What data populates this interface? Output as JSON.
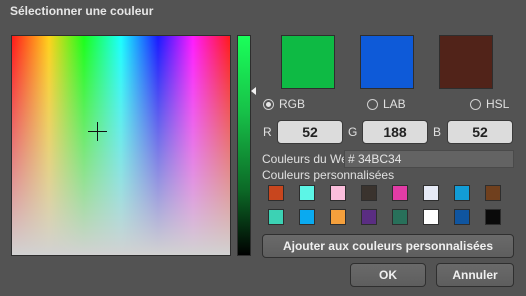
{
  "dialog": {
    "title": "Sélectionner une couleur"
  },
  "preview": {
    "swatches": [
      "#0EBA44",
      "#0E5AD8",
      "#512319"
    ]
  },
  "modes": [
    {
      "label": "RGB",
      "selected": true
    },
    {
      "label": "LAB",
      "selected": false
    },
    {
      "label": "HSL",
      "selected": false
    }
  ],
  "rgb": {
    "r_label": "R",
    "r_value": "52",
    "g_label": "G",
    "g_value": "188",
    "b_label": "B",
    "b_value": "52"
  },
  "web": {
    "label": "Couleurs du Web",
    "hex": "# 34BC34"
  },
  "custom": {
    "label": "Couleurs personnalisées",
    "swatches": [
      "#C8461E",
      "#5CF5E6",
      "#FBBEDC",
      "#3A332E",
      "#E23CA6",
      "#E6EAF6",
      "#129CD6",
      "#70401E",
      "#3CD2B4",
      "#0AAAF0",
      "#F5A03C",
      "#5A2D82",
      "#28705A",
      "#FFFFFF",
      "#0F55A0",
      "#0A0A0A"
    ],
    "add_label": "Ajouter aux couleurs personnalisées"
  },
  "buttons": {
    "ok": "OK",
    "cancel": "Annuler"
  }
}
